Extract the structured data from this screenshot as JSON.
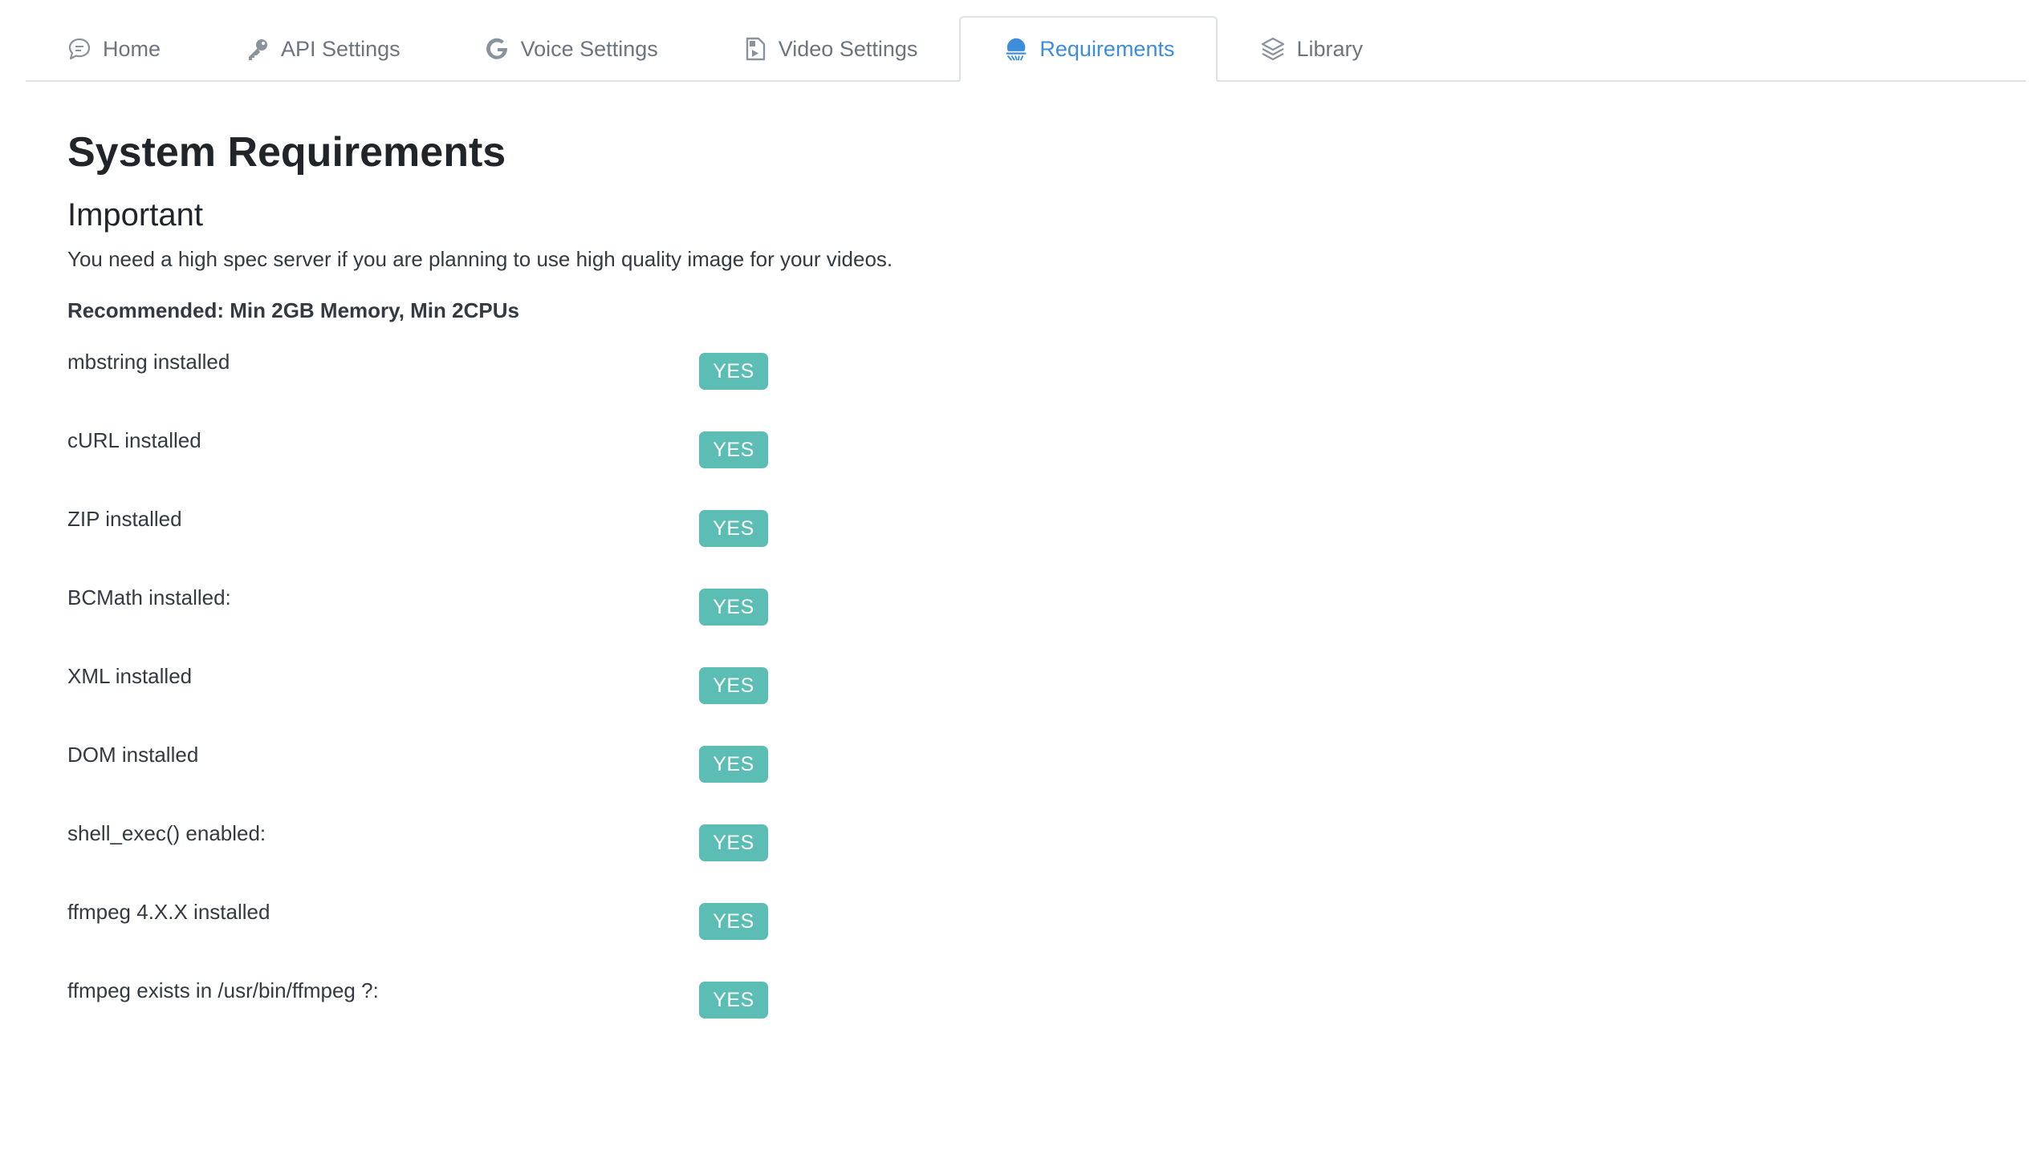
{
  "tabs": [
    {
      "label": "Home",
      "icon": "chat-bubble-icon",
      "active": false
    },
    {
      "label": "API Settings",
      "icon": "key-icon",
      "active": false
    },
    {
      "label": "Voice Settings",
      "icon": "google-g-icon",
      "active": false
    },
    {
      "label": "Video Settings",
      "icon": "video-file-icon",
      "active": false
    },
    {
      "label": "Requirements",
      "icon": "requirements-icon",
      "active": true
    },
    {
      "label": "Library",
      "icon": "layers-icon",
      "active": false
    }
  ],
  "page": {
    "title": "System Requirements",
    "subtitle": "Important",
    "note": "You need a high spec server if you are planning to use high quality image for your videos.",
    "recommended": "Recommended: Min 2GB Memory, Min 2CPUs"
  },
  "requirements": [
    {
      "label": "mbstring installed",
      "status": "YES"
    },
    {
      "label": "cURL installed",
      "status": "YES"
    },
    {
      "label": "ZIP installed",
      "status": "YES"
    },
    {
      "label": "BCMath installed:",
      "status": "YES"
    },
    {
      "label": "XML installed",
      "status": "YES"
    },
    {
      "label": "DOM installed",
      "status": "YES"
    },
    {
      "label": "shell_exec() enabled:",
      "status": "YES"
    },
    {
      "label": "ffmpeg 4.X.X installed",
      "status": "YES"
    },
    {
      "label": "ffmpeg exists in /usr/bin/ffmpeg ?:",
      "status": "YES"
    }
  ],
  "colors": {
    "accent": "#3d8ddb",
    "badge": "#5bbdb4",
    "muted": "#6c757d"
  }
}
